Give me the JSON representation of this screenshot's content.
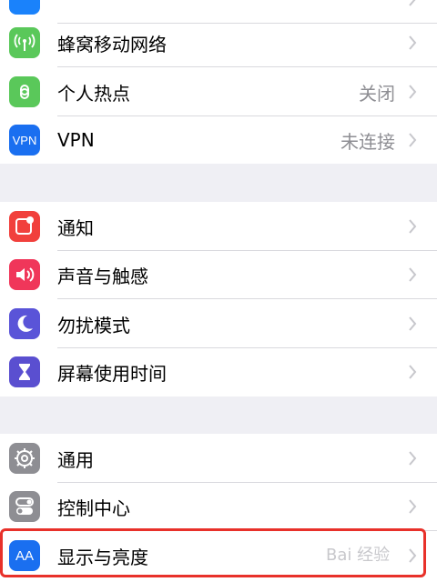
{
  "rows": [
    {
      "label": "",
      "value": "",
      "icon": "bluetooth-icon",
      "color": "#1a82fb"
    },
    {
      "label": "蜂窝移动网络",
      "value": "",
      "icon": "antenna-icon",
      "color": "#5ac85a"
    },
    {
      "label": "个人热点",
      "value": "关闭",
      "icon": "hotspot-icon",
      "color": "#5ac85a"
    },
    {
      "label": "VPN",
      "value": "未连接",
      "icon": "vpn-icon",
      "icon_text": "VPN",
      "color": "#1a6ff0"
    },
    {
      "label": "通知",
      "value": "",
      "icon": "notification-icon",
      "color": "#f1403c"
    },
    {
      "label": "声音与触感",
      "value": "",
      "icon": "speaker-icon",
      "color": "#f0365a"
    },
    {
      "label": "勿扰模式",
      "value": "",
      "icon": "moon-icon",
      "color": "#5a54d8"
    },
    {
      "label": "屏幕使用时间",
      "value": "",
      "icon": "hourglass-icon",
      "color": "#5a4fd0"
    },
    {
      "label": "通用",
      "value": "",
      "icon": "gear-icon",
      "color": "#8e8e93"
    },
    {
      "label": "控制中心",
      "value": "",
      "icon": "toggles-icon",
      "color": "#8e8e93"
    },
    {
      "label": "显示与亮度",
      "value": "",
      "icon": "display-icon",
      "icon_text": "AA",
      "color": "#1a6ff0"
    }
  ],
  "watermark": "Bai 经验",
  "highlight_color": "#e8312a"
}
